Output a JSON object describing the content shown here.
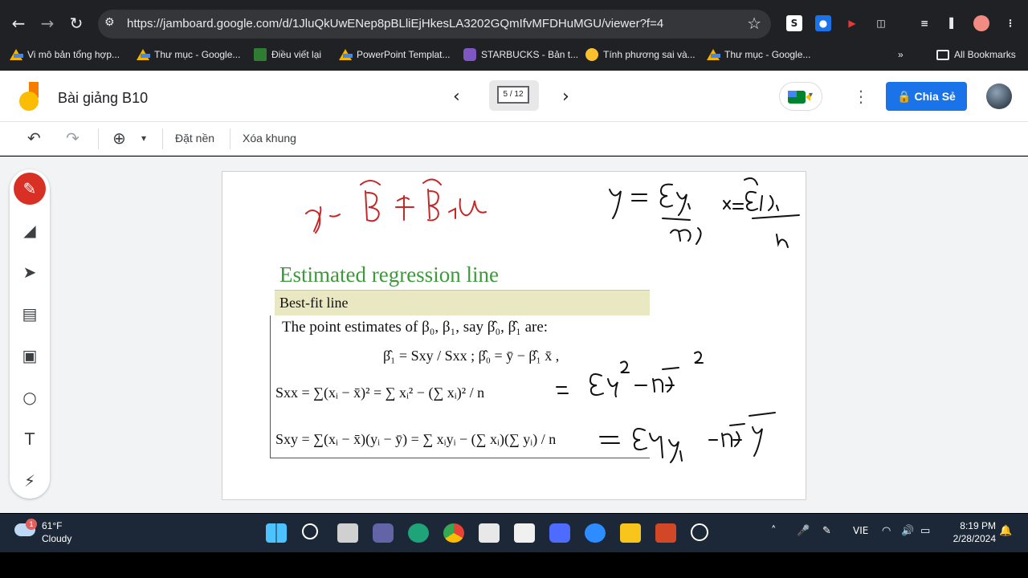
{
  "browser": {
    "url": "https://jamboard.google.com/d/1JluQkUwENep8pBLliEjHkesLA3202GQmIfvMFDHuMGU/viewer?f=4",
    "bookmarks": [
      "Vi mô bản tổng hợp...",
      "Thư mục - Google...",
      "Điều viết lại",
      "PowerPoint Templat...",
      "STARBUCKS - Bản t...",
      "Tính phương sai và...",
      "Thư mục - Google..."
    ],
    "all_bookmarks": "All Bookmarks"
  },
  "app": {
    "title": "Bài giảng B10",
    "pager": "5 / 12",
    "share_label": "Chia Sẻ"
  },
  "toolbar": {
    "set_background": "Đặt nền",
    "clear_frame": "Xóa khung"
  },
  "slide": {
    "title": "Estimated regression line",
    "subtitle": "Best-fit line",
    "intro": "The point estimates of β₀, β₁, say β̂₀, β̂₁ are:",
    "eq1": "β̂₁ = Sxy / Sxx ;  β̂₀ = ȳ − β̂₁ x̄ ,",
    "eq2": "Sxx = ∑(xᵢ − x̄)² = ∑ xᵢ² − (∑ xᵢ)² / n",
    "eq3": "Sxy = ∑(xᵢ − x̄)(yᵢ − ȳ) = ∑ xᵢyᵢ − (∑ xᵢ)(∑ yᵢ) / n"
  },
  "taskbar": {
    "temperature": "61°F",
    "condition": "Cloudy",
    "notification_count": "1",
    "language": "VIE",
    "time": "8:19 PM",
    "date": "2/28/2024"
  }
}
